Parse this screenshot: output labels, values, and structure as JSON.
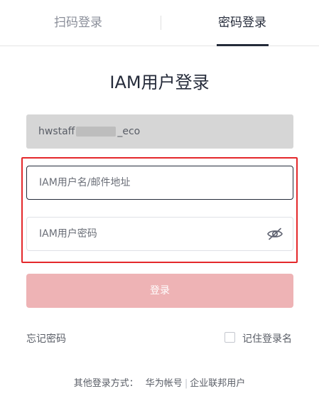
{
  "tabs": {
    "qr_login": "扫码登录",
    "password_login": "密码登录"
  },
  "title": "IAM用户登录",
  "account": {
    "prefix": "hwstaff",
    "suffix": "_eco"
  },
  "username": {
    "placeholder": "IAM用户名/邮件地址",
    "value": ""
  },
  "password": {
    "placeholder": "IAM用户密码",
    "value": ""
  },
  "icons": {
    "eye": "eye-slash-icon"
  },
  "login_button": "登录",
  "forgot_password": "忘记密码",
  "remember_me": {
    "label": "记住登录名",
    "checked": false
  },
  "other_login": {
    "label": "其他登录方式：",
    "huawei_account": "华为帐号",
    "separator": "|",
    "federated_user": "企业联邦用户"
  },
  "colors": {
    "highlight_border": "#e4282b",
    "login_button_bg": "#eeb3b5",
    "active_tab": "#252b3a"
  }
}
